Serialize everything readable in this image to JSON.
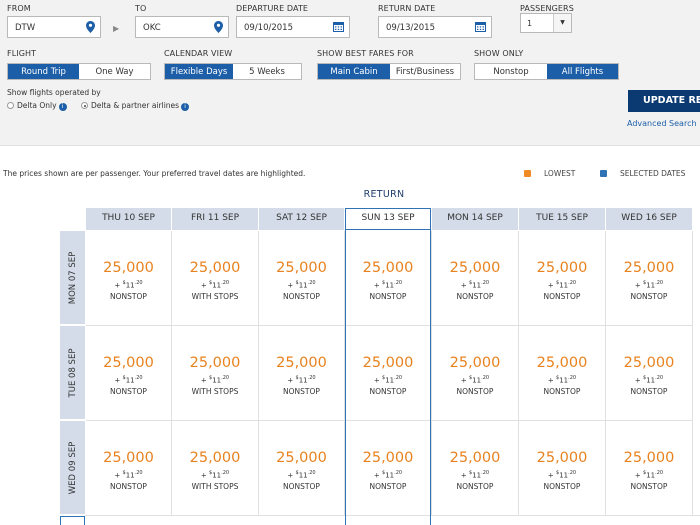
{
  "search": {
    "from_label": "FROM",
    "from_value": "DTW",
    "to_label": "TO",
    "to_value": "OKC",
    "depart_label": "DEPARTURE DATE",
    "depart_value": "09/10/2015",
    "return_label": "RETURN DATE",
    "return_value": "09/13/2015",
    "passengers_label": "PASSENGERS",
    "passengers_value": "1",
    "flight_label": "FLIGHT",
    "flight_options": [
      "Round Trip",
      "One Way"
    ],
    "calendar_label": "CALENDAR VIEW",
    "calendar_options": [
      "Flexible Days",
      "5 Weeks"
    ],
    "fares_label": "SHOW BEST FARES FOR",
    "fares_options": [
      "Main Cabin",
      "First/Business"
    ],
    "showonly_label": "SHOW ONLY",
    "showonly_options": [
      "Nonstop",
      "All Flights"
    ],
    "operated_label": "Show flights operated by",
    "operated_options": [
      "Delta Only",
      "Delta & partner airlines"
    ],
    "update_label": "UPDATE RES",
    "advanced_label": "Advanced Search",
    "accent": "#1c5fa8"
  },
  "results": {
    "note": "The prices shown are per passenger. Your preferred travel dates are highlighted.",
    "legend_lowest": "LOWEST",
    "legend_selected": "SELECTED DATES",
    "lowest_color": "#f08a24",
    "selected_color": "#2f73b4",
    "return_title": "RETURN",
    "columns": [
      "THU 10 SEP",
      "FRI 11 SEP",
      "SAT 12 SEP",
      "SUN 13 SEP",
      "MON 14 SEP",
      "TUE 15 SEP",
      "WED 16 SEP"
    ],
    "rows": [
      {
        "label": "MON 07 SEP",
        "cells": [
          {
            "miles": "25,000",
            "dollar": "$",
            "tax": "11",
            "cents": ".20",
            "stops": "NONSTOP"
          },
          {
            "miles": "25,000",
            "dollar": "$",
            "tax": "11",
            "cents": ".20",
            "stops": "WITH STOPS"
          },
          {
            "miles": "25,000",
            "dollar": "$",
            "tax": "11",
            "cents": ".20",
            "stops": "NONSTOP"
          },
          {
            "miles": "25,000",
            "dollar": "$",
            "tax": "11",
            "cents": ".20",
            "stops": "NONSTOP"
          },
          {
            "miles": "25,000",
            "dollar": "$",
            "tax": "11",
            "cents": ".20",
            "stops": "NONSTOP"
          },
          {
            "miles": "25,000",
            "dollar": "$",
            "tax": "11",
            "cents": ".20",
            "stops": "NONSTOP"
          },
          {
            "miles": "25,000",
            "dollar": "$",
            "tax": "11",
            "cents": ".20",
            "stops": "NONSTOP"
          }
        ]
      },
      {
        "label": "TUE 08 SEP",
        "cells": [
          {
            "miles": "25,000",
            "dollar": "$",
            "tax": "11",
            "cents": ".20",
            "stops": "NONSTOP"
          },
          {
            "miles": "25,000",
            "dollar": "$",
            "tax": "11",
            "cents": ".20",
            "stops": "WITH STOPS"
          },
          {
            "miles": "25,000",
            "dollar": "$",
            "tax": "11",
            "cents": ".20",
            "stops": "NONSTOP"
          },
          {
            "miles": "25,000",
            "dollar": "$",
            "tax": "11",
            "cents": ".20",
            "stops": "NONSTOP"
          },
          {
            "miles": "25,000",
            "dollar": "$",
            "tax": "11",
            "cents": ".20",
            "stops": "NONSTOP"
          },
          {
            "miles": "25,000",
            "dollar": "$",
            "tax": "11",
            "cents": ".20",
            "stops": "NONSTOP"
          },
          {
            "miles": "25,000",
            "dollar": "$",
            "tax": "11",
            "cents": ".20",
            "stops": "NONSTOP"
          }
        ]
      },
      {
        "label": "WED 09 SEP",
        "cells": [
          {
            "miles": "25,000",
            "dollar": "$",
            "tax": "11",
            "cents": ".20",
            "stops": "NONSTOP"
          },
          {
            "miles": "25,000",
            "dollar": "$",
            "tax": "11",
            "cents": ".20",
            "stops": "WITH STOPS"
          },
          {
            "miles": "25,000",
            "dollar": "$",
            "tax": "11",
            "cents": ".20",
            "stops": "NONSTOP"
          },
          {
            "miles": "25,000",
            "dollar": "$",
            "tax": "11",
            "cents": ".20",
            "stops": "NONSTOP"
          },
          {
            "miles": "25,000",
            "dollar": "$",
            "tax": "11",
            "cents": ".20",
            "stops": "NONSTOP"
          },
          {
            "miles": "25,000",
            "dollar": "$",
            "tax": "11",
            "cents": ".20",
            "stops": "NONSTOP"
          },
          {
            "miles": "25,000",
            "dollar": "$",
            "tax": "11",
            "cents": ".20",
            "stops": "NONSTOP"
          }
        ]
      }
    ]
  }
}
